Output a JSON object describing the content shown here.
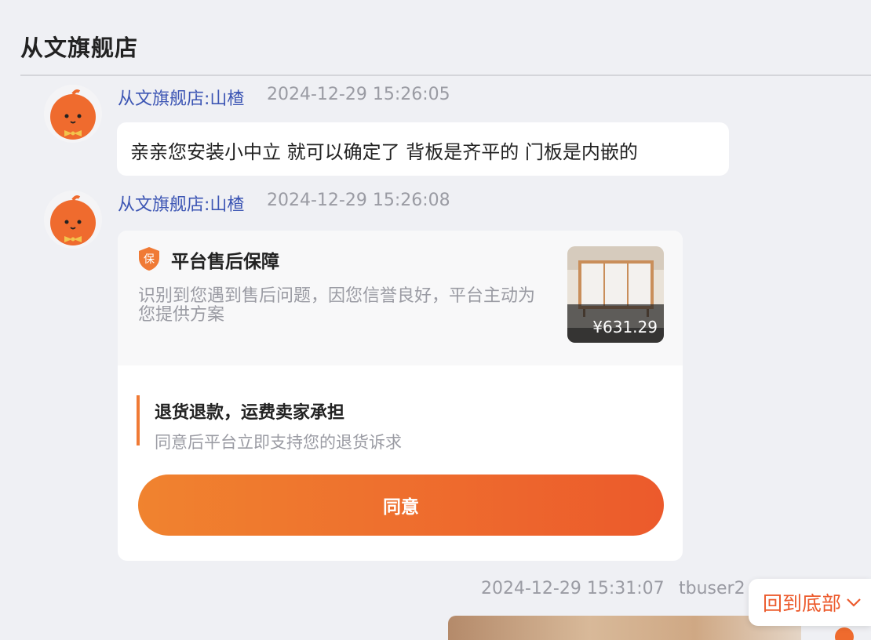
{
  "header": {
    "title": "从文旗舰店"
  },
  "messages": [
    {
      "sender": "从文旗舰店:山楂",
      "time": "2024-12-29 15:26:05",
      "text": "亲亲您安装小中立 就可以确定了 背板是齐平的 门板是内嵌的"
    },
    {
      "sender": "从文旗舰店:山楂",
      "time": "2024-12-29 15:26:08"
    }
  ],
  "card": {
    "badge_char": "保",
    "title": "平台售后保障",
    "description": "识别到您遇到售后问题，因您信誉良好，平台主动为您提供方案",
    "product_price": "¥631.29",
    "option_title": "退货退款，运费卖家承担",
    "option_desc": "同意后平台立即支持您的退货诉求",
    "agree_label": "同意"
  },
  "my_message": {
    "time": "2024-12-29 15:31:07",
    "user": "tbuser2"
  },
  "back_to_bottom": {
    "label": "回到底部"
  },
  "colors": {
    "accent": "#ec5a2c",
    "link": "#3d56b4",
    "background": "#eff0f4"
  }
}
